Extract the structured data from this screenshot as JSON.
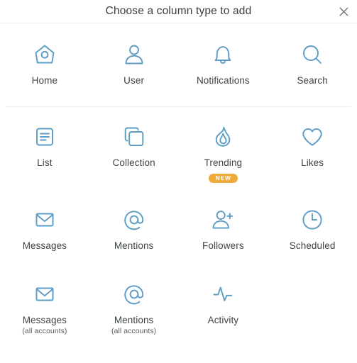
{
  "dialog": {
    "title": "Choose a column type to add",
    "close_label": "×",
    "close_icon": "close-icon",
    "accent_color": "#5b9cc4",
    "label_color": "#3f4447",
    "badge_color": "#edab3a",
    "divider_color": "#ececec",
    "background": "#ffffff"
  },
  "rows": [
    {
      "divider_after": true,
      "cells": [
        {
          "label": "Home",
          "sublabel": "",
          "icon": "home-icon",
          "badge": "",
          "name": "column-type-home"
        },
        {
          "label": "User",
          "sublabel": "",
          "icon": "user-icon",
          "badge": "",
          "name": "column-type-user"
        },
        {
          "label": "Notifications",
          "sublabel": "",
          "icon": "bell-icon",
          "badge": "",
          "name": "column-type-notifications"
        },
        {
          "label": "Search",
          "sublabel": "",
          "icon": "search-icon",
          "badge": "",
          "name": "column-type-search"
        }
      ]
    },
    {
      "divider_after": false,
      "cells": [
        {
          "label": "List",
          "sublabel": "",
          "icon": "list-icon",
          "badge": "",
          "name": "column-type-list"
        },
        {
          "label": "Collection",
          "sublabel": "",
          "icon": "collection-icon",
          "badge": "",
          "name": "column-type-collection"
        },
        {
          "label": "Trending",
          "sublabel": "",
          "icon": "flame-icon",
          "badge": "NEW",
          "name": "column-type-trending"
        },
        {
          "label": "Likes",
          "sublabel": "",
          "icon": "heart-icon",
          "badge": "",
          "name": "column-type-likes"
        }
      ]
    },
    {
      "divider_after": false,
      "cells": [
        {
          "label": "Messages",
          "sublabel": "",
          "icon": "envelope-icon",
          "badge": "",
          "name": "column-type-messages"
        },
        {
          "label": "Mentions",
          "sublabel": "",
          "icon": "at-icon",
          "badge": "",
          "name": "column-type-mentions"
        },
        {
          "label": "Followers",
          "sublabel": "",
          "icon": "user-plus-icon",
          "badge": "",
          "name": "column-type-followers"
        },
        {
          "label": "Scheduled",
          "sublabel": "",
          "icon": "clock-icon",
          "badge": "",
          "name": "column-type-scheduled"
        }
      ]
    },
    {
      "divider_after": false,
      "cells": [
        {
          "label": "Messages",
          "sublabel": "(all accounts)",
          "icon": "envelope-icon",
          "badge": "",
          "name": "column-type-messages-all-accounts"
        },
        {
          "label": "Mentions",
          "sublabel": "(all accounts)",
          "icon": "at-icon",
          "badge": "",
          "name": "column-type-mentions-all-accounts"
        },
        {
          "label": "Activity",
          "sublabel": "",
          "icon": "pulse-icon",
          "badge": "",
          "name": "column-type-activity"
        },
        {
          "label": "",
          "sublabel": "",
          "icon": "",
          "badge": "",
          "name": "column-type-empty-slot"
        }
      ]
    }
  ]
}
